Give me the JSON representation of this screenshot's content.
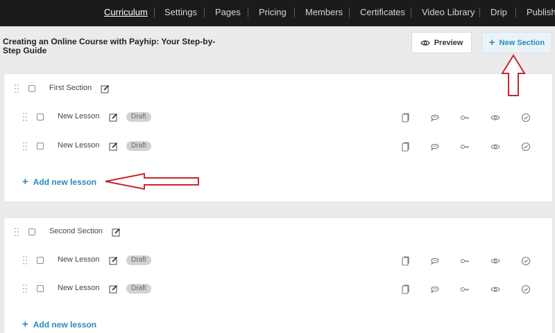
{
  "nav": {
    "items": [
      {
        "label": "Curriculum",
        "active": true
      },
      {
        "label": "Settings"
      },
      {
        "label": "Pages"
      },
      {
        "label": "Pricing"
      },
      {
        "label": "Members"
      },
      {
        "label": "Certificates"
      },
      {
        "label": "Video Library"
      },
      {
        "label": "Drip"
      },
      {
        "label": "Publish"
      }
    ]
  },
  "header": {
    "course_title": "Creating an Online Course with Payhip: Your Step-by-Step Guide",
    "preview_label": "Preview",
    "new_section_label": "New Section"
  },
  "sections": [
    {
      "title": "First Section",
      "lessons": [
        {
          "title": "New Lesson",
          "status": "Draft"
        },
        {
          "title": "New Lesson",
          "status": "Draft"
        }
      ],
      "add_lesson_label": "Add new lesson"
    },
    {
      "title": "Second Section",
      "lessons": [
        {
          "title": "New Lesson",
          "status": "Draft"
        },
        {
          "title": "New Lesson",
          "status": "Draft"
        }
      ],
      "add_lesson_label": "Add new lesson"
    }
  ],
  "icons": {
    "lesson_actions": [
      "copy-icon",
      "comment-icon",
      "key-icon",
      "eye-icon",
      "check-circle-icon"
    ],
    "edit": "pencil-icon",
    "drag": "drag-handle-icon",
    "preview": "eye-icon",
    "annotation": "red-arrow"
  },
  "colors": {
    "accent": "#2a8ab8",
    "nav_bg": "#1b1b1b",
    "badge_bg": "#d2d2d2",
    "annotation": "#c9252b"
  }
}
